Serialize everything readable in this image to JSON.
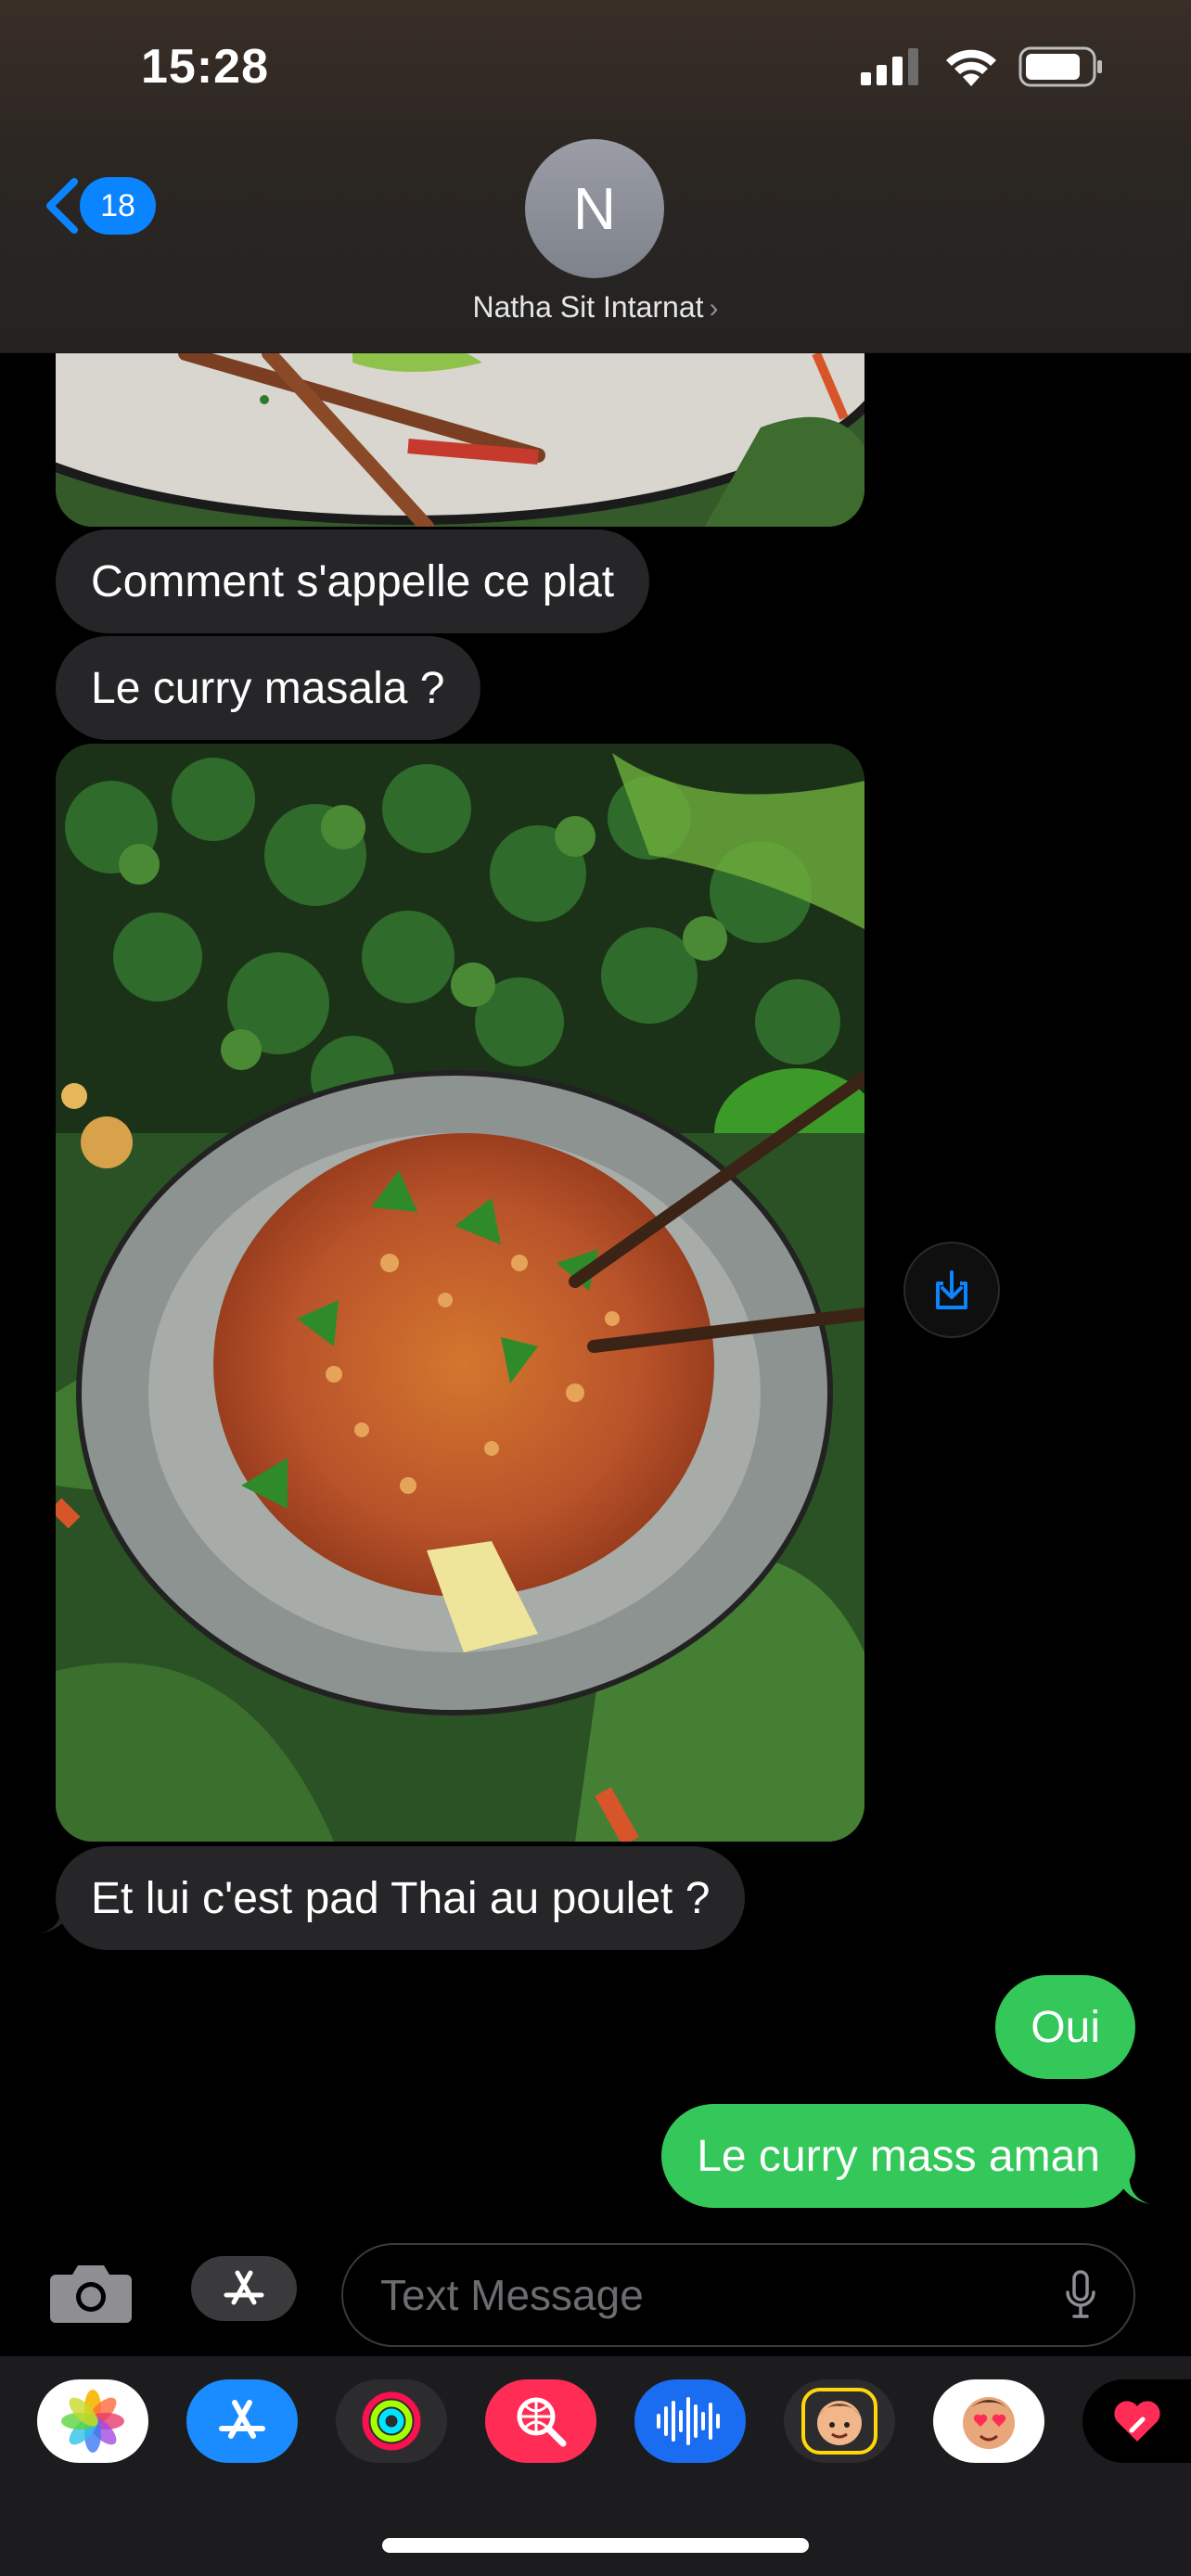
{
  "status_bar": {
    "time": "15:28"
  },
  "header": {
    "back_count": "18",
    "avatar_initial": "N",
    "contact_name": "Natha Sit Intarnat"
  },
  "messages": [
    {
      "from": "them",
      "kind": "photo",
      "description": "partial photo of plate with chopsticks"
    },
    {
      "from": "them",
      "kind": "text",
      "text": "Comment s'appelle ce plat"
    },
    {
      "from": "them",
      "kind": "text",
      "text": "Le curry masala ?"
    },
    {
      "from": "them",
      "kind": "photo",
      "description": "bowl of pad thai with chopsticks, herbs and lemon"
    },
    {
      "from": "them",
      "kind": "text",
      "text": "Et lui c'est pad Thai au poulet ?"
    },
    {
      "from": "me",
      "kind": "text",
      "text": "Oui"
    },
    {
      "from": "me",
      "kind": "text",
      "text": "Le curry mass aman"
    }
  ],
  "composer": {
    "placeholder": "Text Message"
  },
  "app_drawer": [
    "photos-app",
    "app-store-app",
    "activity-app",
    "search-images-app",
    "audio-message-app",
    "memoji-app",
    "memoji-stickers-app",
    "digital-touch-app"
  ],
  "colors": {
    "accent": "#0a84ff",
    "outgoing": "#34c759",
    "incoming": "#262628"
  }
}
